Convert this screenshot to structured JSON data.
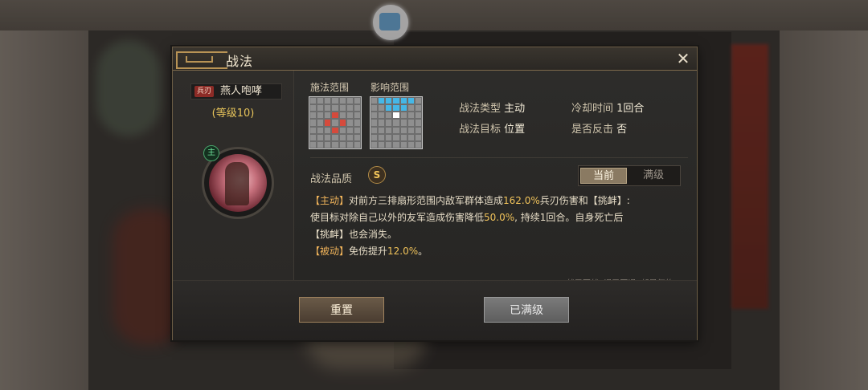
{
  "dialog": {
    "title": "战法",
    "close_symbol": "✕"
  },
  "hero": {
    "troop_tag": "兵刃",
    "name": "燕人咆哮",
    "level": "(等级10)",
    "badge": "主"
  },
  "ranges": {
    "cast_label": "施法范围",
    "effect_label": "影响范围"
  },
  "info": {
    "type_label": "战法类型",
    "type_value": "主动",
    "cooldown_label": "冷却时间",
    "cooldown_value": "1回合",
    "target_label": "战法目标",
    "target_value": "位置",
    "counter_label": "是否反击",
    "counter_value": "否"
  },
  "quality": {
    "label": "战法品质",
    "grade": "S"
  },
  "toggle": {
    "current": "当前",
    "max": "满级"
  },
  "description": {
    "l1a": "【主动】",
    "l1b": "对前方三排扇形范围内敌军群体造成",
    "l1c": "162.0%",
    "l1d": "兵刃伤害和【挑衅】:",
    "l2a": "使目标对除自己以外的友军造成伤害降低",
    "l2b": "50.0%",
    "l2c": ", 持续1回合。自身死亡后",
    "l3": "【挑衅】也会消失。",
    "l4a": "【被动】",
    "l4b": "免伤提升",
    "l4c": "12.0%",
    "l4d": "。"
  },
  "quote": "“战又不战, 退又不退, 却是何故!”",
  "buttons": {
    "reset": "重置",
    "maxed": "已满级"
  },
  "colors": {
    "accent": "#e6c35a",
    "troop_red": "#8c2b26",
    "range_red": "#d64a3c",
    "range_blue": "#45b7e6"
  }
}
